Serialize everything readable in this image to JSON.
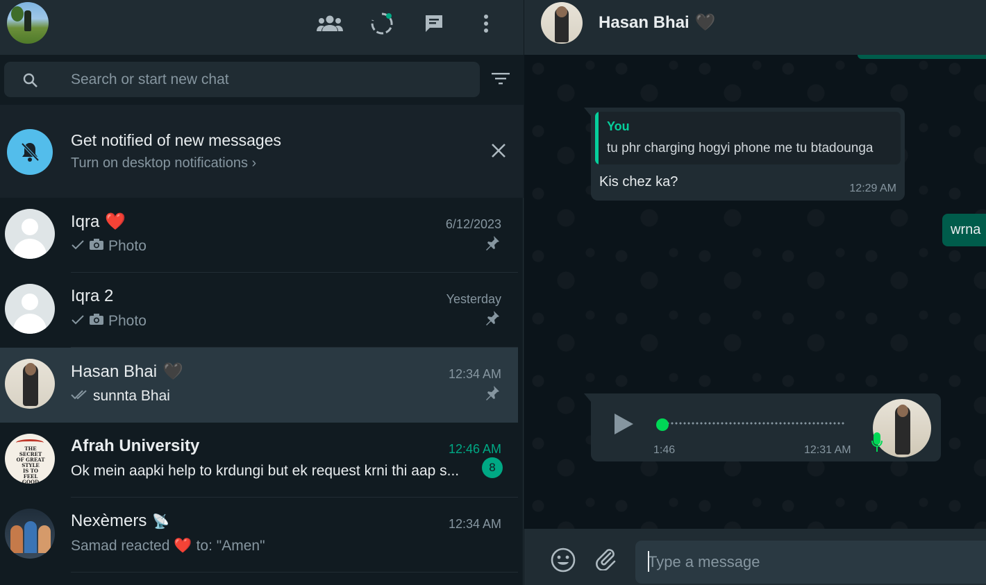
{
  "left_header": {
    "icons": [
      "communities-icon",
      "status-icon",
      "new-chat-icon",
      "menu-icon"
    ]
  },
  "search": {
    "placeholder": "Search or start new chat"
  },
  "notification_banner": {
    "title": "Get notified of new messages",
    "subtitle": "Turn on desktop notifications ›"
  },
  "chats": [
    {
      "name": "Iqra",
      "emoji": "❤️",
      "time": "6/12/2023",
      "preview": "Photo",
      "ticks": "single",
      "pinned": true
    },
    {
      "name": "Iqra 2",
      "emoji": "",
      "time": "Yesterday",
      "preview": "Photo",
      "ticks": "single",
      "pinned": true
    },
    {
      "name": "Hasan Bhai",
      "emoji": "🖤",
      "time": "12:34 AM",
      "preview": "sunnta Bhai",
      "ticks": "double",
      "pinned": true,
      "active": true
    },
    {
      "name": "Afrah University",
      "emoji": "",
      "time": "12:46 AM",
      "preview": "Ok mein aapki help to krdungi but ek request krni thi aap s...",
      "unread": "8"
    },
    {
      "name": "Nexèmers",
      "emoji": "📡",
      "time": "12:34 AM",
      "preview_prefix": "Samad reacted",
      "preview_emoji": "❤️",
      "preview_suffix": "to: \"Amen\""
    }
  ],
  "conversation": {
    "contact_name": "Hasan Bhai",
    "contact_emoji": "🖤",
    "quoted_message": {
      "author": "You",
      "text": "tu phr charging hogyi phone me tu btadounga",
      "reply": "Kis chez ka?",
      "time": "12:29 AM"
    },
    "partial_outgoing": "wrna",
    "voice_note": {
      "duration": "1:46",
      "time": "12:31 AM",
      "progress": 0
    }
  },
  "composer": {
    "placeholder": "Type a message"
  },
  "colors": {
    "accent": "#00a884",
    "panel": "#202c33",
    "background": "#111b21",
    "outgoing": "#005c4b"
  }
}
